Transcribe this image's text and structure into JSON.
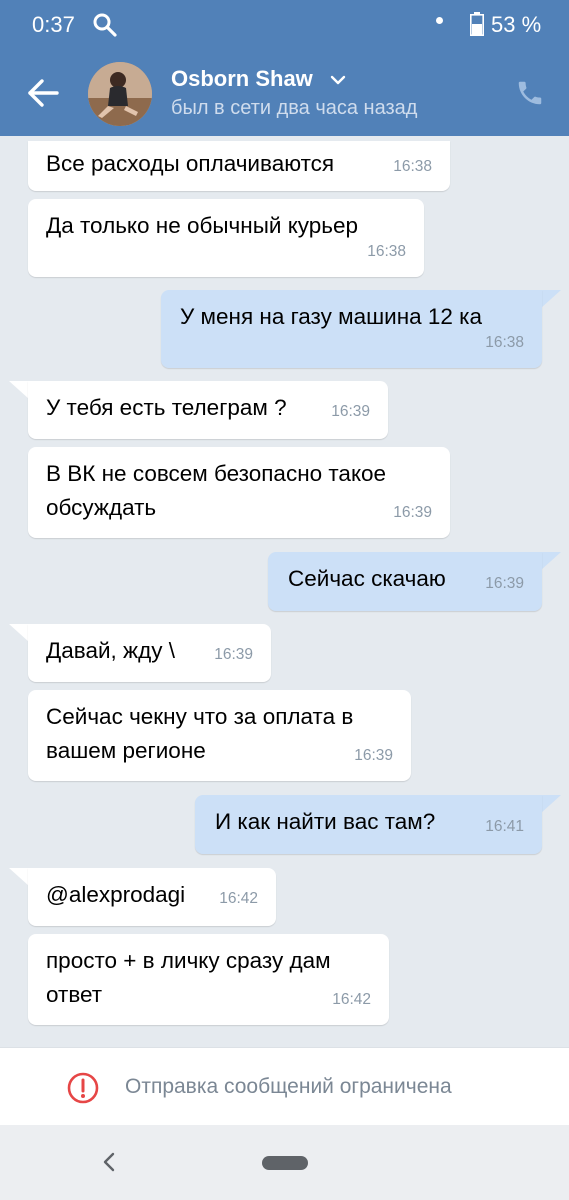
{
  "status_bar": {
    "time": "0:37",
    "battery_percent": "53 %",
    "icons": [
      "search-icon",
      "notification-dot-icon",
      "battery-icon"
    ]
  },
  "header": {
    "name": "Osborn Shaw",
    "status": "был в сети два часа назад",
    "icons": [
      "back-arrow-icon",
      "chevron-down-icon",
      "phone-icon"
    ],
    "accent_color": "#5181b8"
  },
  "messages": [
    {
      "direction": "in",
      "text": "Все расходы оплачиваются",
      "time": "16:38"
    },
    {
      "direction": "in",
      "text": "Да только не обычный курьер",
      "time": "16:38"
    },
    {
      "direction": "out",
      "text": "У меня на газу машина 12 ка",
      "time": "16:38"
    },
    {
      "direction": "in",
      "text": "У тебя есть телеграм ?",
      "time": "16:39"
    },
    {
      "direction": "in",
      "text": "В ВК не совсем безопасно такое\nобсуждать",
      "time": "16:39"
    },
    {
      "direction": "out",
      "text": "Сейчас скачаю",
      "time": "16:39"
    },
    {
      "direction": "in",
      "text": "Давай, жду \\",
      "time": "16:39"
    },
    {
      "direction": "in",
      "text": "Сейчас чекну что за оплата в\nвашем регионе",
      "time": "16:39"
    },
    {
      "direction": "out",
      "text": "И как найти вас там?",
      "time": "16:41"
    },
    {
      "direction": "in",
      "text": "@alexprodagi",
      "time": "16:42"
    },
    {
      "direction": "in",
      "text": "просто + в личку сразу дам\nответ",
      "time": "16:42"
    }
  ],
  "footer": {
    "restriction_text": "Отправка сообщений ограничена",
    "icon": "warning-icon",
    "warning_color": "#e64646"
  },
  "nav_bar": {
    "icons": [
      "nav-back-icon",
      "nav-home-pill"
    ]
  }
}
